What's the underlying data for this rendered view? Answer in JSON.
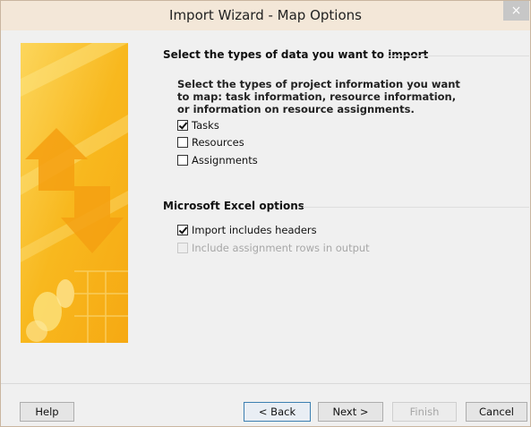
{
  "window": {
    "title": "Import Wizard - Map Options",
    "close_glyph": "×"
  },
  "section_data_types": {
    "title": "Select the types of data you want to import",
    "description": "Select the types of project information you want to map: task information, resource information, or information on resource assignments.",
    "options": [
      {
        "label": "Tasks",
        "checked": true,
        "enabled": true
      },
      {
        "label": "Resources",
        "checked": false,
        "enabled": true
      },
      {
        "label": "Assignments",
        "checked": false,
        "enabled": true
      }
    ]
  },
  "section_excel": {
    "title": "Microsoft Excel options",
    "options": [
      {
        "label": "Import includes headers",
        "checked": true,
        "enabled": true
      },
      {
        "label": "Include assignment rows in output",
        "checked": false,
        "enabled": false
      }
    ]
  },
  "buttons": {
    "help": "Help",
    "back": "< Back",
    "next": "Next >",
    "finish": "Finish",
    "cancel": "Cancel"
  },
  "icons": {
    "close": "close-icon",
    "wizard_art": "wizard-banner-image"
  },
  "colors": {
    "titlebar": "#f3e7d8",
    "art_primary": "#f7b21b",
    "art_light": "#fbd45a",
    "accent_border": "#3c7fb1"
  }
}
